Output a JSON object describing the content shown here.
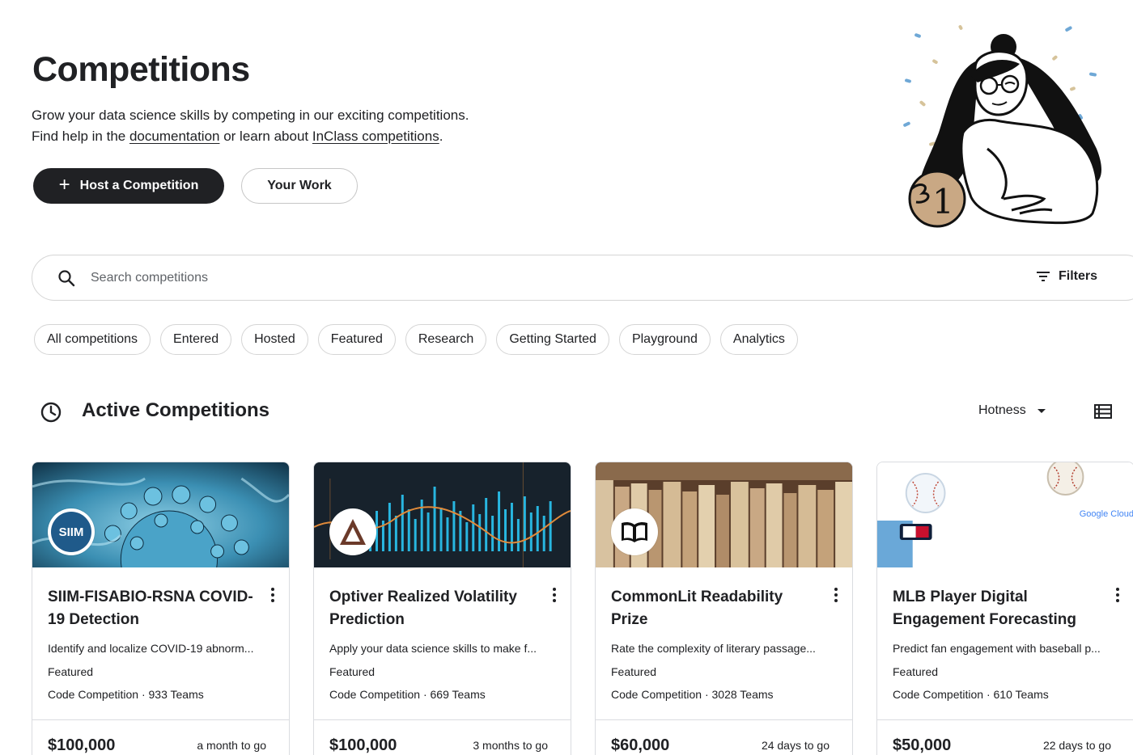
{
  "header": {
    "title": "Competitions",
    "desc_line1": "Grow your data science skills by competing in our exciting competitions.",
    "desc_prefix": "Find help in the ",
    "doc_link": "documentation",
    "desc_mid": " or learn about ",
    "inclass_link": "InClass competitions",
    "desc_suffix": ".",
    "host_button": "Host a Competition",
    "work_button": "Your Work",
    "illustration_badge": "1"
  },
  "search": {
    "placeholder": "Search competitions",
    "filters_label": "Filters"
  },
  "chips": [
    "All competitions",
    "Entered",
    "Hosted",
    "Featured",
    "Research",
    "Getting Started",
    "Playground",
    "Analytics"
  ],
  "section": {
    "title": "Active Competitions",
    "sort_label": "Hotness"
  },
  "cards": [
    {
      "title": "SIIM-FISABIO-RSNA COVID-19 Detection",
      "description": "Identify and localize COVID-19 abnorm...",
      "category": "Featured",
      "meta": "Code Competition · 933 Teams",
      "prize": "$100,000",
      "deadline": "a month to go",
      "logo_text": "SIIM"
    },
    {
      "title": "Optiver Realized Volatility Prediction",
      "description": "Apply your data science skills to make f...",
      "category": "Featured",
      "meta": "Code Competition · 669 Teams",
      "prize": "$100,000",
      "deadline": "3 months to go",
      "logo_text": ""
    },
    {
      "title": "CommonLit Readability Prize",
      "description": "Rate the complexity of literary passage...",
      "category": "Featured",
      "meta": "Code Competition · 3028 Teams",
      "prize": "$60,000",
      "deadline": "24 days to go",
      "logo_text": ""
    },
    {
      "title": "MLB Player Digital Engagement Forecasting",
      "description": "Predict fan engagement with baseball p...",
      "category": "Featured",
      "meta": "Code Competition · 610 Teams",
      "prize": "$50,000",
      "deadline": "22 days to go",
      "logo_text": "",
      "sponsor": "Google Cloud"
    }
  ],
  "colors": {
    "primary_dark": "#202124",
    "border": "#dadce0",
    "covid_blue": "#3b8fb3",
    "optiver_cyan": "#28b6e0",
    "book_tan": "#c9a884",
    "google_blue": "#4285f4"
  }
}
